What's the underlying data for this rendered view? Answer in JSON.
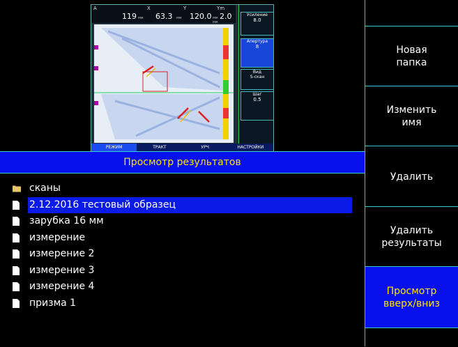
{
  "screen_title": "Просмотр результатов",
  "thumbnail": {
    "readouts": [
      {
        "label": "A",
        "value": "119",
        "unit": "мм"
      },
      {
        "label": "X",
        "value": "63.3",
        "unit": "мм"
      },
      {
        "label": "Y",
        "value": "120.0",
        "unit": "мм"
      },
      {
        "label": "Ym",
        "value": "2.0",
        "unit": "мм"
      }
    ],
    "params": {
      "gain_label": "Усиление",
      "gain_value": "8.0",
      "aperture_label": "Апертура",
      "aperture_value": "8",
      "view_label": "Вид",
      "view_value": "S-скан",
      "step_label": "Шаг",
      "step_value": "0.5"
    },
    "menu": [
      "РЕЖИМ",
      "ТРАКТ",
      "УРЧ",
      "НАСТРОЙКИ"
    ]
  },
  "files": [
    {
      "name": "сканы",
      "type": "folder",
      "selected": false
    },
    {
      "name": "2.12.2016 тестовый образец",
      "type": "file",
      "selected": true
    },
    {
      "name": "зарубка 16 мм",
      "type": "file",
      "selected": false
    },
    {
      "name": "измерение",
      "type": "file",
      "selected": false
    },
    {
      "name": "измерение 2",
      "type": "file",
      "selected": false
    },
    {
      "name": "измерение 3",
      "type": "file",
      "selected": false
    },
    {
      "name": "измерение 4",
      "type": "file",
      "selected": false
    },
    {
      "name": "призма 1",
      "type": "file",
      "selected": false
    }
  ],
  "side_buttons": [
    {
      "label": "",
      "active": false
    },
    {
      "label": "Новая папка",
      "active": false
    },
    {
      "label": "Изменить имя",
      "active": false
    },
    {
      "label": "Удалить",
      "active": false
    },
    {
      "label": "Удалить результаты",
      "active": false
    },
    {
      "label": "Просмотр вверх/вниз",
      "active": true
    },
    {
      "label": "",
      "active": false
    }
  ],
  "colors": {
    "accent": "#0810EE",
    "highlight_text": "#FFE600",
    "border": "#33CCCC",
    "folder": "#E8C46A"
  }
}
